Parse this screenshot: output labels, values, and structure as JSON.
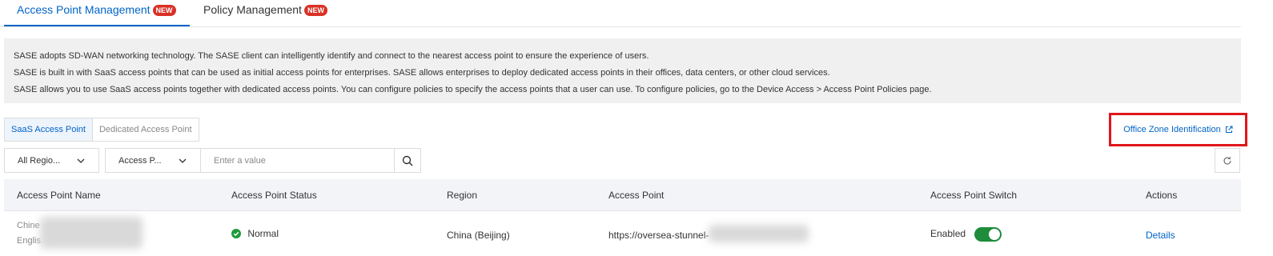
{
  "top_tabs": [
    {
      "label": "Access Point Management",
      "badge": "NEW",
      "active": true
    },
    {
      "label": "Policy Management",
      "badge": "NEW",
      "active": false
    }
  ],
  "notice": {
    "lines": [
      "SASE adopts SD-WAN networking technology. The SASE client can intelligently identify and connect to the nearest access point to ensure the experience of users.",
      "SASE is built in with SaaS access points that can be used as initial access points for enterprises. SASE allows enterprises to deploy dedicated access points in their offices, data centers, or other cloud services.",
      "SASE allows you to use SaaS access points together with dedicated access points. You can configure policies to specify the access points that a user can use. To configure policies, go to the Device Access > Access Point Policies page."
    ]
  },
  "segments": [
    {
      "label": "SaaS Access Point",
      "active": true
    },
    {
      "label": "Dedicated Access Point",
      "active": false
    }
  ],
  "office_link": {
    "label": "Office Zone Identification",
    "icon": "external-link-icon"
  },
  "filters": {
    "region_select": "All Regio...",
    "field_select": "Access P...",
    "search_placeholder": "Enter a value"
  },
  "table": {
    "columns": [
      "Access Point Name",
      "Access Point Status",
      "Region",
      "Access Point",
      "Access Point Switch",
      "Actions"
    ],
    "rows": [
      {
        "name_line1": "Chine",
        "name_line2": "Englis",
        "status": "Normal",
        "region": "China (Beijing)",
        "access_point": "https://oversea-stunnel-",
        "switch_label": "Enabled",
        "switch_on": true,
        "action": "Details"
      }
    ]
  },
  "colors": {
    "accent": "#0064c8",
    "badge": "#d93026",
    "success": "#1e9b3c",
    "highlight": "#e0161b"
  }
}
